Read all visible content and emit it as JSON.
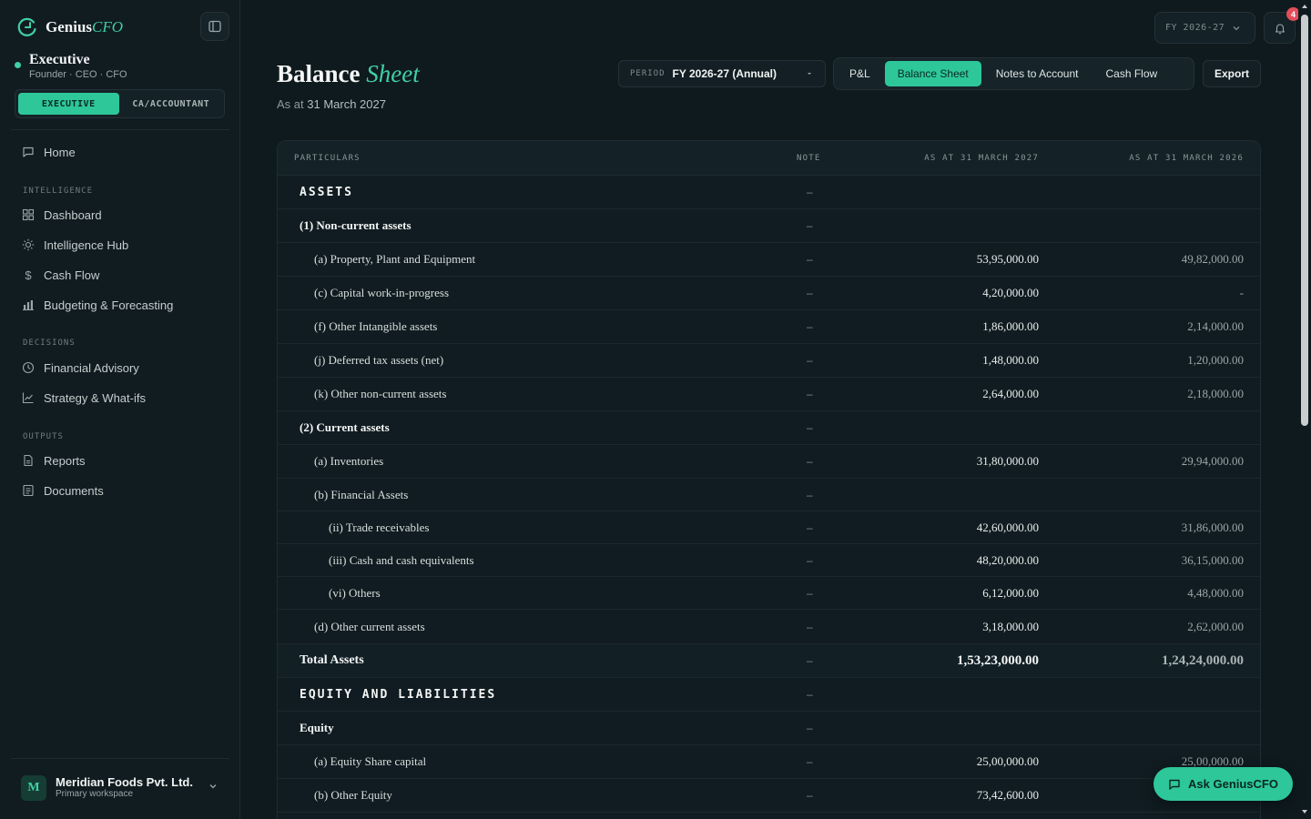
{
  "brand": {
    "name": "Genius",
    "accent": "CFO"
  },
  "role": {
    "title": "Executive",
    "subtitle": "Founder · CEO · CFO"
  },
  "mode_toggle": {
    "executive": "EXECUTIVE",
    "accountant": "CA/ACCOUNTANT",
    "active": "executive"
  },
  "nav": {
    "home": "Home",
    "sections": {
      "intelligence": "INTELLIGENCE",
      "decisions": "DECISIONS",
      "outputs": "OUTPUTS"
    },
    "items": {
      "dashboard": "Dashboard",
      "intelligence_hub": "Intelligence Hub",
      "cash_flow": "Cash Flow",
      "budgeting": "Budgeting & Forecasting",
      "advisory": "Financial Advisory",
      "strategy": "Strategy & What-ifs",
      "reports": "Reports",
      "documents": "Documents"
    }
  },
  "workspace": {
    "initial": "M",
    "name": "Meridian Foods Pvt. Ltd.",
    "subtitle": "Primary workspace"
  },
  "topbar": {
    "fy_label": "FY 2026-27",
    "notification_count": "4"
  },
  "header": {
    "title_main": "Balance",
    "title_accent": "Sheet",
    "subtitle_prefix": "As at",
    "subtitle_date": "31 March 2027",
    "period_label": "PERIOD",
    "period_value": "FY 2026-27 (Annual)",
    "tabs": {
      "pl": "P&L",
      "bs": "Balance Sheet",
      "notes": "Notes to Account",
      "cf": "Cash Flow"
    },
    "active_tab": "bs",
    "export_label": "Export"
  },
  "table": {
    "headers": {
      "particulars": "PARTICULARS",
      "note": "NOTE",
      "current": "AS AT 31 MARCH 2027",
      "previous": "AS AT 31 MARCH 2026"
    },
    "rows": [
      {
        "label": "ASSETS",
        "note": "–",
        "current": "",
        "previous": ""
      },
      {
        "label": "(1) Non-current assets",
        "note": "–",
        "current": "",
        "previous": ""
      },
      {
        "label": "(a) Property, Plant and Equipment",
        "note": "–",
        "current": "53,95,000.00",
        "previous": "49,82,000.00"
      },
      {
        "label": "(c) Capital work-in-progress",
        "note": "–",
        "current": "4,20,000.00",
        "previous": "-"
      },
      {
        "label": "(f) Other Intangible assets",
        "note": "–",
        "current": "1,86,000.00",
        "previous": "2,14,000.00"
      },
      {
        "label": "(j) Deferred tax assets (net)",
        "note": "–",
        "current": "1,48,000.00",
        "previous": "1,20,000.00"
      },
      {
        "label": "(k) Other non-current assets",
        "note": "–",
        "current": "2,64,000.00",
        "previous": "2,18,000.00"
      },
      {
        "label": "(2) Current assets",
        "note": "–",
        "current": "",
        "previous": ""
      },
      {
        "label": "(a) Inventories",
        "note": "–",
        "current": "31,80,000.00",
        "previous": "29,94,000.00"
      },
      {
        "label": "(b) Financial Assets",
        "note": "–",
        "current": "",
        "previous": ""
      },
      {
        "label": "(ii) Trade receivables",
        "note": "–",
        "current": "42,60,000.00",
        "previous": "31,86,000.00"
      },
      {
        "label": "(iii) Cash and cash equivalents",
        "note": "–",
        "current": "48,20,000.00",
        "previous": "36,15,000.00"
      },
      {
        "label": "(vi) Others",
        "note": "–",
        "current": "6,12,000.00",
        "previous": "4,48,000.00"
      },
      {
        "label": "(d) Other current assets",
        "note": "–",
        "current": "3,18,000.00",
        "previous": "2,62,000.00"
      },
      {
        "label": "Total Assets",
        "note": "–",
        "current": "1,53,23,000.00",
        "previous": "1,24,24,000.00"
      },
      {
        "label": "EQUITY AND LIABILITIES",
        "note": "–",
        "current": "",
        "previous": ""
      },
      {
        "label": "Equity",
        "note": "–",
        "current": "",
        "previous": ""
      },
      {
        "label": "(a) Equity Share capital",
        "note": "–",
        "current": "25,00,000.00",
        "previous": "25,00,000.00"
      },
      {
        "label": "(b) Other Equity",
        "note": "–",
        "current": "73,42,600.00",
        "previous": ""
      }
    ]
  },
  "ask_button": "Ask GeniusCFO",
  "colors": {
    "accent": "#2ec79a",
    "background": "#0f1a1e",
    "sidebar": "#111c21",
    "badge": "#e34d5a"
  }
}
